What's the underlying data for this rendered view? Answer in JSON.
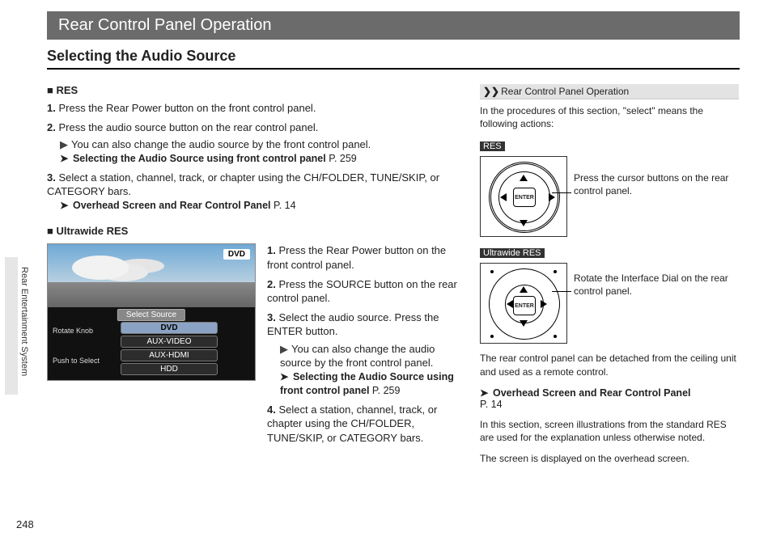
{
  "title_bar": "Rear Control Panel Operation",
  "section_title": "Selecting the Audio Source",
  "page_number": "248",
  "side_label": "Rear Entertainment System",
  "res_heading": "RES",
  "res_steps": {
    "s1": "Press the Rear Power button on the front control panel.",
    "s2": "Press the audio source button on the rear control panel.",
    "s2_note": "You can also change the audio source by the front control panel.",
    "s2_ref_title": "Selecting the Audio Source using front control panel",
    "s2_ref_page": "P. 259",
    "s3": "Select a station, channel, track, or chapter using the CH/FOLDER, TUNE/SKIP, or CATEGORY bars.",
    "s3_ref_title": "Overhead Screen and Rear Control Panel",
    "s3_ref_page": "P. 14"
  },
  "uw_heading": "Ultrawide RES",
  "screenshot": {
    "badge": "DVD",
    "title": "Select Source",
    "left1": "Rotate Knob",
    "left2": "Push to Select",
    "item1": "DVD",
    "item2": "AUX-VIDEO",
    "item3": "AUX-HDMI",
    "item4": "HDD"
  },
  "uw_steps": {
    "s1": "Press the Rear Power button on the front control panel.",
    "s2": "Press the SOURCE button on the rear control panel.",
    "s3": "Select the audio source. Press the ENTER button.",
    "s3_note": "You can also change the audio source by the front control panel.",
    "s3_ref_title": "Selecting the Audio Source using front control panel",
    "s3_ref_page": "P. 259",
    "s4": "Select a station, channel, track, or chapter using the CH/FOLDER, TUNE/SKIP, or CATEGORY bars."
  },
  "sidebar": {
    "header_icon": "❯❯",
    "header_text": "Rear Control Panel Operation",
    "intro": "In the procedures of this section, \"select\" means the following actions:",
    "tag_res": "RES",
    "callout_res": "Press the cursor buttons on the rear control panel.",
    "tag_uw": "Ultrawide RES",
    "callout_uw": "Rotate the Interface Dial on the rear control panel.",
    "enter_label": "ENTER",
    "detach_note": "The rear control panel can be detached from the ceiling unit and used as a remote control.",
    "ref_title": "Overhead Screen and Rear Control Panel",
    "ref_page": "P. 14",
    "illus_note": "In this section, screen illustrations from the standard RES are used for the explanation unless otherwise noted.",
    "overhead_note": "The screen is displayed on the overhead screen."
  }
}
